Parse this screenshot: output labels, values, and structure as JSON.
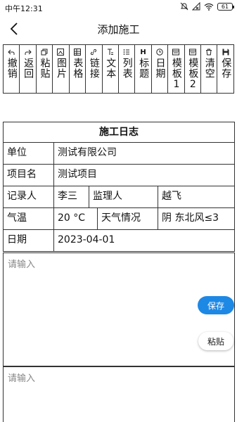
{
  "status": {
    "time": "中午12:31",
    "battery": "61"
  },
  "header": {
    "title": "添加施工"
  },
  "toolbar": [
    {
      "label": "撤销",
      "icon": "undo-icon"
    },
    {
      "label": "返回",
      "icon": "redo-icon"
    },
    {
      "label": "粘贴",
      "icon": "paste-icon"
    },
    {
      "label": "图片",
      "icon": "image-icon"
    },
    {
      "label": "表格",
      "icon": "table-icon"
    },
    {
      "label": "链接",
      "icon": "link-icon"
    },
    {
      "label": "文本",
      "icon": "text-icon"
    },
    {
      "label": "列表",
      "icon": "list-icon"
    },
    {
      "label": "标题",
      "icon": "heading-icon",
      "glyph": "H"
    },
    {
      "label": "日期",
      "icon": "clock-icon"
    },
    {
      "label": "模板1",
      "icon": "template-icon"
    },
    {
      "label": "模板2",
      "icon": "template-icon"
    },
    {
      "label": "清空",
      "icon": "trash-icon"
    },
    {
      "label": "保存",
      "icon": "save-icon"
    }
  ],
  "form": {
    "title": "施工日志",
    "unit_label": "单位",
    "unit_value": "测试有限公司",
    "project_label": "项目名",
    "project_value": "测试项目",
    "recorder_label": "记录人",
    "recorder_value": "李三",
    "supervisor_label": "监理人",
    "supervisor_value": "越飞",
    "temp_label": "气温",
    "temp_value": "20 °C",
    "weather_label": "天气情况",
    "weather_value": "阴 东北风≤3",
    "date_label": "日期",
    "date_value": "2023-04-01"
  },
  "editor": {
    "placeholder": "请输入",
    "save_label": "保存",
    "paste_label": "粘贴",
    "placeholder2": "请输入"
  },
  "colors": {
    "accent": "#1e88e5"
  }
}
